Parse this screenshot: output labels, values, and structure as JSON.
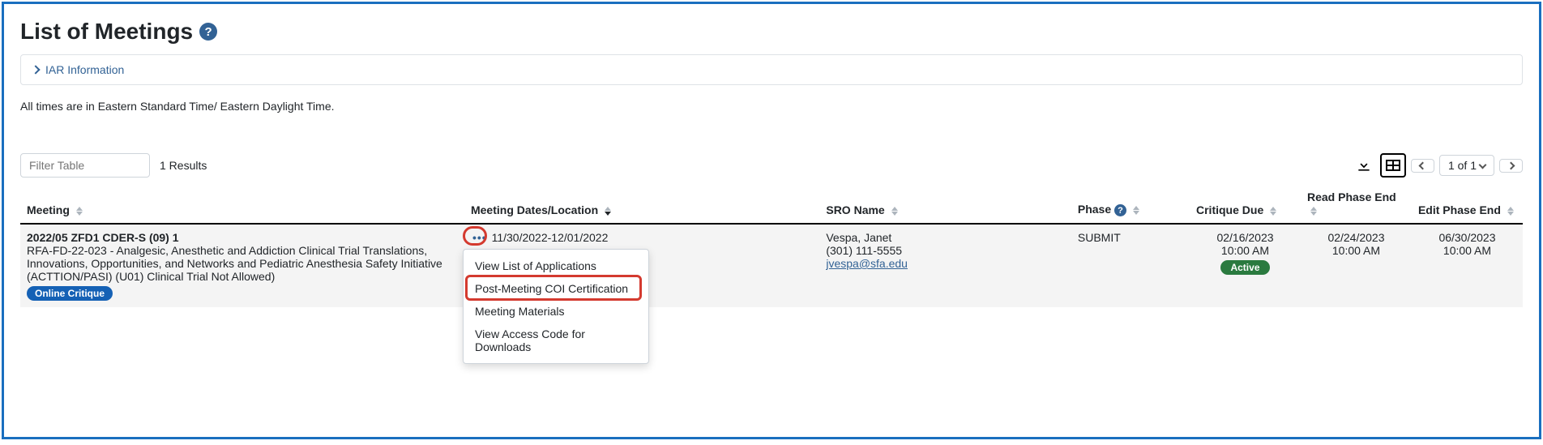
{
  "page": {
    "title": "List of Meetings",
    "iar_panel_label": "IAR Information",
    "timezone_note": "All times are in Eastern Standard Time/ Eastern Daylight Time."
  },
  "toolbar": {
    "filter_placeholder": "Filter Table",
    "results_text": "1 Results",
    "page_indicator": "1 of 1"
  },
  "columns": {
    "meeting": "Meeting",
    "dates": "Meeting Dates/Location",
    "sro": "SRO Name",
    "phase": "Phase",
    "critique_due": "Critique Due",
    "read_phase_end": "Read Phase End",
    "edit_phase_end": "Edit Phase End"
  },
  "row": {
    "meeting_code": "2022/05 ZFD1 CDER-S (09) 1",
    "meeting_desc": "RFA-FD-22-023 - Analgesic, Anesthetic and Addiction Clinical Trial Translations, Innovations, Opportunities, and Networks and Pediatric Anesthesia Safety Initiative (ACTTION/PASI) (U01) Clinical Trial Not Allowed)",
    "online_critique_badge": "Online Critique",
    "dates": "11/30/2022-12/01/2022",
    "sro_name": "Vespa, Janet",
    "sro_phone": "(301) 111-5555",
    "sro_email": "jvespa@sfa.edu",
    "phase": "SUBMIT",
    "critique_due_date": "02/16/2023",
    "critique_due_time": "10:00 AM",
    "critique_status": "Active",
    "read_end_date": "02/24/2023",
    "read_end_time": "10:00 AM",
    "edit_end_date": "06/30/2023",
    "edit_end_time": "10:00 AM"
  },
  "menu": {
    "item1": "View List of Applications",
    "item2": "Post-Meeting COI Certification",
    "item3": "Meeting Materials",
    "item4": "View Access Code for Downloads"
  }
}
